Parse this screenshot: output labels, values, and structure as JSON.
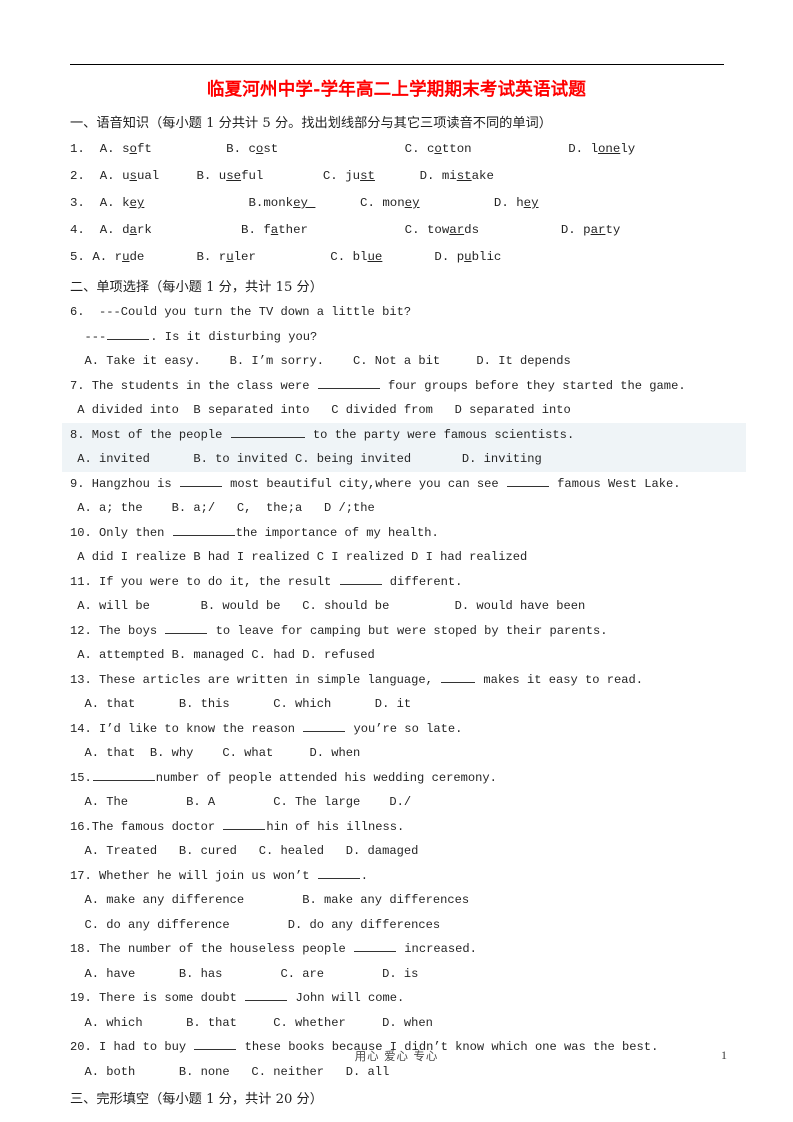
{
  "document": {
    "title": "临夏河州中学-学年高二上学期期末考试英语试题",
    "title_color": "#ff0000",
    "page_number": "1",
    "footer_motto": "用心 爱心 专心",
    "highlight_color": "#eef4f7"
  },
  "section1": {
    "heading": "一、语音知识（每小题 1 分共计 5 分。找出划线部分与其它三项读音不同的单词）",
    "items": [
      {
        "number": "1.",
        "options": [
          {
            "letter": "A.",
            "pre": "s",
            "mark": "o",
            "post": "ft"
          },
          {
            "letter": "B.",
            "pre": "c",
            "mark": "o",
            "post": "st"
          },
          {
            "letter": "C.",
            "pre": "c",
            "mark": "o",
            "post": "tton"
          },
          {
            "letter": "D.",
            "pre": "l",
            "mark": "one",
            "post": "ly"
          }
        ]
      },
      {
        "number": "2.",
        "options": [
          {
            "letter": "A.",
            "pre": "u",
            "mark": "s",
            "post": "ual"
          },
          {
            "letter": "B.",
            "pre": "u",
            "mark": "se",
            "post": "ful"
          },
          {
            "letter": "C.",
            "pre": "ju",
            "mark": "st",
            "post": ""
          },
          {
            "letter": "D.",
            "pre": "mi",
            "mark": "st",
            "post": "ake"
          }
        ]
      },
      {
        "number": "3.",
        "options": [
          {
            "letter": "A.",
            "pre": "k",
            "mark": "ey",
            "post": ""
          },
          {
            "letter": "B.",
            "pre": "monk",
            "mark": "ey ",
            "post": ""
          },
          {
            "letter": "C.",
            "pre": "mon",
            "mark": "ey",
            "post": ""
          },
          {
            "letter": "D.",
            "pre": "h",
            "mark": "ey",
            "post": ""
          }
        ]
      },
      {
        "number": "4.",
        "options": [
          {
            "letter": "A.",
            "pre": "d",
            "mark": "a",
            "post": "rk"
          },
          {
            "letter": "B.",
            "pre": "f",
            "mark": "a",
            "post": "ther"
          },
          {
            "letter": "C.",
            "pre": "tow",
            "mark": "ar",
            "post": "ds"
          },
          {
            "letter": "D.",
            "pre": "p",
            "mark": "ar",
            "post": "ty"
          }
        ]
      },
      {
        "number": "5.",
        "options": [
          {
            "letter": "A.",
            "pre": "r",
            "mark": "u",
            "post": "de"
          },
          {
            "letter": "B.",
            "pre": "r",
            "mark": "u",
            "post": "ler"
          },
          {
            "letter": "C.",
            "pre": "bl",
            "mark": "ue",
            "post": ""
          },
          {
            "letter": "D.",
            "pre": "p",
            "mark": "u",
            "post": "blic"
          }
        ]
      }
    ]
  },
  "section2": {
    "heading": "二、单项选择（每小题 1 分，共计 15 分）",
    "q6": {
      "stem1": "6.  ---Could you turn the TV down a little bit?",
      "stem2_pre": "  ---",
      "stem2_post": ". Is it disturbing you?",
      "options": "  A. Take it easy.    B. I’m sorry.    C. Not a bit     D. It depends"
    },
    "q7": {
      "stem_pre": "7. The students in the class were ",
      "stem_post": " four groups before they started the game.",
      "options": " A divided into  B separated into   C divided from   D separated into"
    },
    "q8": {
      "stem_pre": "8. Most of the people ",
      "stem_post": " to the party were famous scientists.",
      "options": " A. invited      B. to invited C. being invited       D. inviting",
      "highlighted": true
    },
    "q9": {
      "stem_pre": "9. Hangzhou is ",
      "stem_mid": " most beautiful city,where you can see ",
      "stem_post": " famous West Lake.",
      "options": " A. a; the    B. a;/   C,  the;a   D /;the"
    },
    "q10": {
      "stem_pre": "10. Only then ",
      "stem_post": "the importance of my health.",
      "options": " A did I realize B had I realized C I realized D I had realized"
    },
    "q11": {
      "stem_pre": "11. If you were to do it, the result ",
      "stem_post": " different.",
      "options": " A. will be       B. would be   C. should be         D. would have been"
    },
    "q12": {
      "stem_pre": "12. The boys ",
      "stem_post": " to leave for camping but were stoped by their parents.",
      "options": " A. attempted B. managed C. had D. refused"
    },
    "q13": {
      "stem_pre": "13. These articles are written in simple language, ",
      "stem_post": " makes it easy to read.",
      "options": "  A. that      B. this      C. which      D. it"
    },
    "q14": {
      "stem_pre": "14. I’d like to know the reason ",
      "stem_post": " you’re so late.",
      "options": "  A. that  B. why    C. what     D. when"
    },
    "q15": {
      "stem_pre": "15.",
      "stem_post": "number of people attended his wedding ceremony.",
      "options": "  A. The        B. A        C. The large    D./"
    },
    "q16": {
      "stem_pre": "16.The famous doctor ",
      "stem_post": "hin of his illness.",
      "options": "  A. Treated   B. cured   C. healed   D. damaged"
    },
    "q17": {
      "stem_pre": "17. Whether he will join us won’t ",
      "stem_post": ".",
      "options_a": "  A. make any difference        B. make any differences",
      "options_b": "  C. do any difference        D. do any differences"
    },
    "q18": {
      "stem_pre": "18. The number of the houseless people ",
      "stem_post": " increased.",
      "options": "  A. have      B. has        C. are        D. is"
    },
    "q19": {
      "stem_pre": "19. There is some doubt ",
      "stem_post": " John will come.",
      "options": "  A. which      B. that     C. whether     D. when"
    },
    "q20": {
      "stem_pre": "20. I had to buy ",
      "stem_post": " these books because I didn’t know which one was the best.",
      "options": "  A. both      B. none   C. neither   D. all"
    }
  },
  "section3": {
    "heading": "三、完形填空（每小题 1 分，共计 20 分）"
  }
}
